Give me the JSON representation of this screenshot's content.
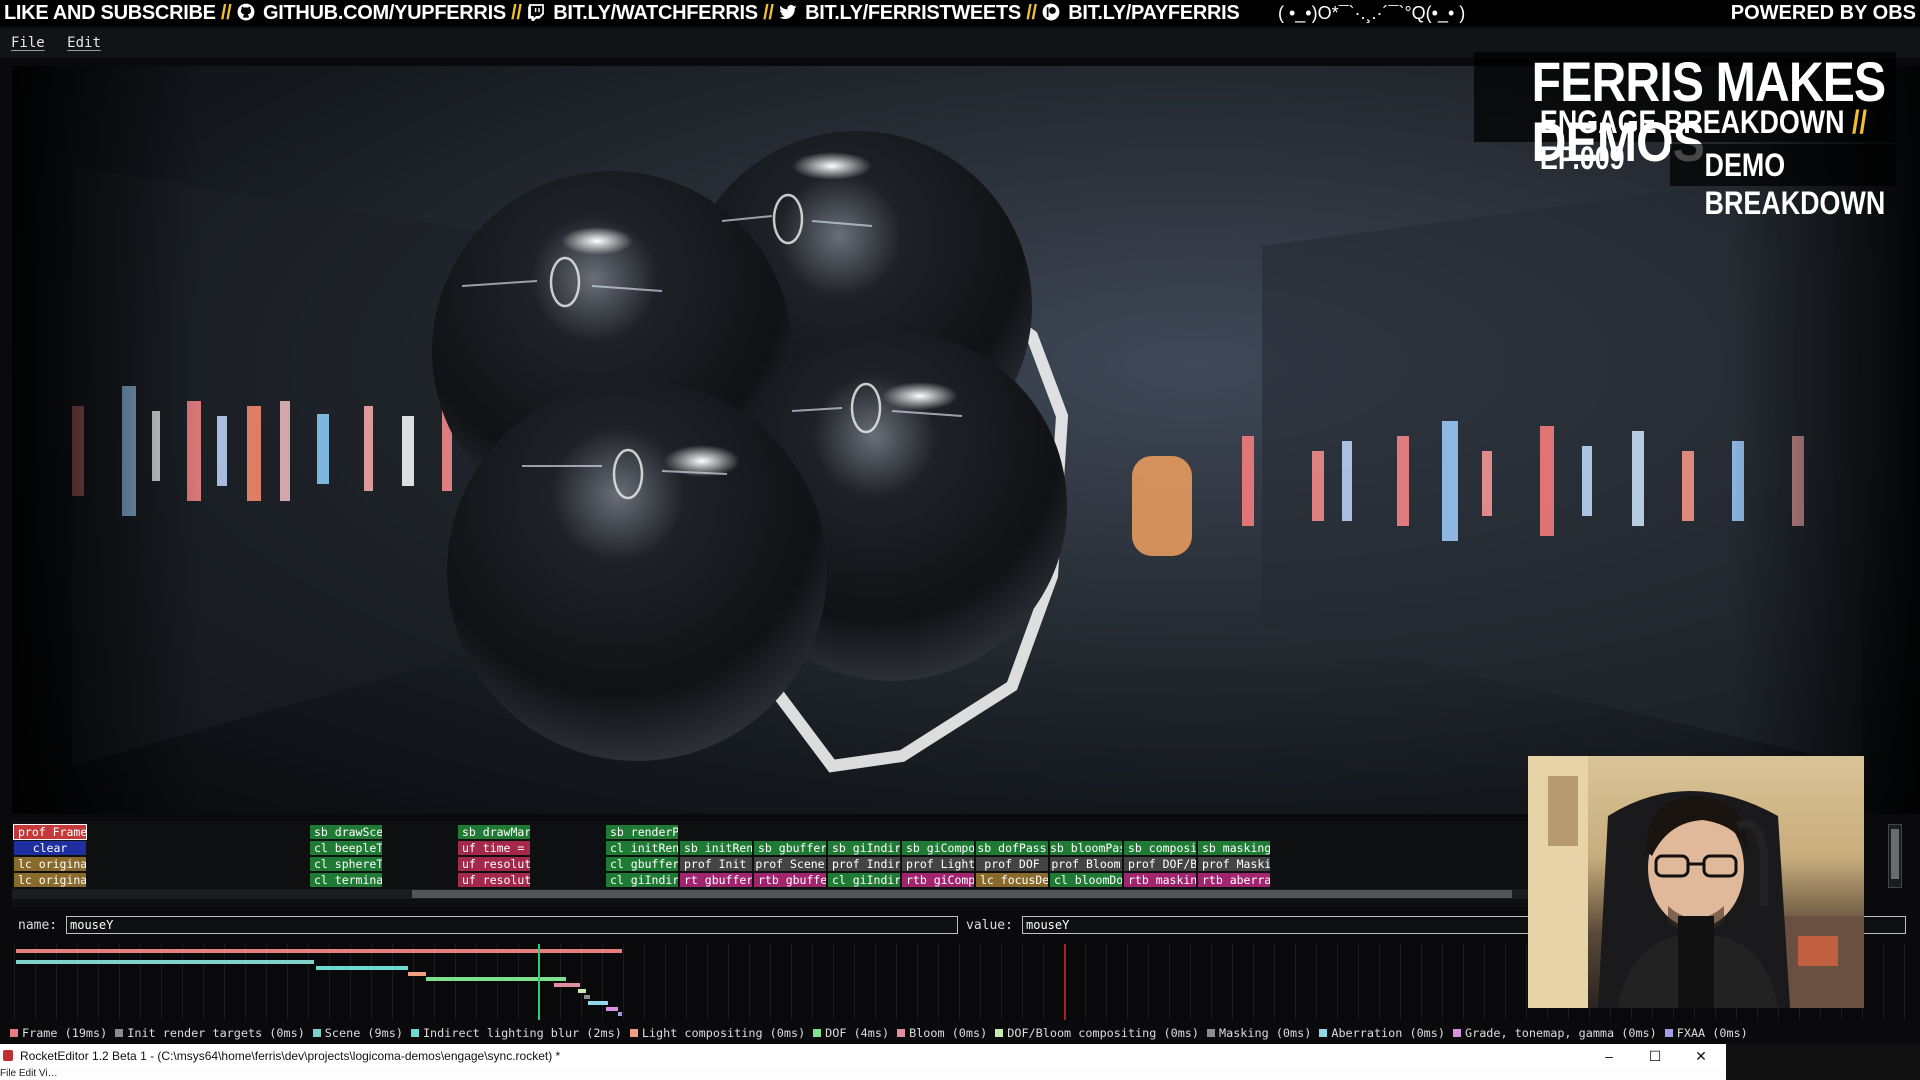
{
  "ticker": {
    "left_parts": [
      "LIKE AND SUBSCRIBE",
      "GITHUB.COM/YUPFERRIS",
      "BIT.LY/WATCHFERRIS",
      "BIT.LY/FERRISTWEETS",
      "BIT.LY/PAYFERRIS"
    ],
    "separator": "//",
    "emoticon": "( •_•)O*¯`·.¸.·´¯`°Q(•_• )",
    "right": "POWERED BY OBS",
    "icons": [
      "github-icon",
      "twitch-icon",
      "twitter-icon",
      "patreon-icon"
    ]
  },
  "menu": {
    "file": "File",
    "edit": "Edit"
  },
  "banner": {
    "title": "FERRIS MAKES DEMOS",
    "subtitle_a": "ENGAGE BREAKDOWN",
    "subtitle_sep": "//",
    "subtitle_b": "EP.009",
    "tag": "DEMO BREAKDOWN"
  },
  "tracks": {
    "columns": [
      {
        "col": 0,
        "cells": [
          {
            "text": "prof Frame",
            "color": "#c43a3a",
            "outline": true
          },
          {
            "text": "clear",
            "color": "#1e2fa0",
            "center": true
          },
          {
            "text": "lc original…",
            "color": "#8a6a2a"
          },
          {
            "text": "lc original…",
            "color": "#8a6a2a"
          }
        ]
      },
      {
        "col": 1,
        "cells": []
      },
      {
        "col": 2,
        "cells": []
      },
      {
        "col": 3,
        "cells": []
      },
      {
        "col": 4,
        "cells": [
          {
            "text": "sb drawScene",
            "color": "#1f7a33"
          },
          {
            "text": "cl beepleTu…",
            "color": "#1f7a33"
          },
          {
            "text": "cl sphereTh…",
            "color": "#1f7a33"
          },
          {
            "text": "cl terminat…",
            "color": "#1f7a33"
          }
        ]
      },
      {
        "col": 5,
        "cells": []
      },
      {
        "col": 6,
        "cells": [
          {
            "text": "sb drawMarc…",
            "color": "#1f7a33"
          },
          {
            "text": "uf time = t…",
            "color": "#a3284a"
          },
          {
            "text": "uf resoluti…",
            "color": "#a3284a"
          },
          {
            "text": "uf resoluti…",
            "color": "#a3284a"
          }
        ]
      },
      {
        "col": 7,
        "cells": []
      },
      {
        "col": 8,
        "cells": [
          {
            "text": "sb renderPi…",
            "color": "#1f7a33"
          },
          {
            "text": "cl initRend…",
            "color": "#1f7a33"
          },
          {
            "text": "cl gbufferP…",
            "color": "#1f7a33"
          },
          {
            "text": "cl giIndire…",
            "color": "#1f7a33"
          }
        ]
      },
      {
        "col": 9,
        "cells": [
          null,
          {
            "text": "sb initRend…",
            "color": "#1f7a33"
          },
          {
            "text": "prof Init r…",
            "color": "#444"
          },
          {
            "text": "rt gbufferT…",
            "color": "#a0256e"
          }
        ]
      },
      {
        "col": 10,
        "cells": [
          null,
          {
            "text": "sb gbufferP…",
            "color": "#1f7a33"
          },
          {
            "text": "prof Scene",
            "color": "#444",
            "center": true
          },
          {
            "text": "rtb gbuffer…",
            "color": "#a0256e"
          }
        ]
      },
      {
        "col": 11,
        "cells": [
          null,
          {
            "text": "sb giIndire…",
            "color": "#1f7a33"
          },
          {
            "text": "prof Indire…",
            "color": "#444"
          },
          {
            "text": "cl giIndire…",
            "color": "#1f7a33"
          }
        ]
      },
      {
        "col": 12,
        "cells": [
          null,
          {
            "text": "sb giCompos…",
            "color": "#1f7a33"
          },
          {
            "text": "prof Light …",
            "color": "#444"
          },
          {
            "text": "rtb giCompo…",
            "color": "#a0256e"
          }
        ]
      },
      {
        "col": 13,
        "cells": [
          null,
          {
            "text": "sb dofPass",
            "color": "#1f7a33",
            "center": true
          },
          {
            "text": "prof DOF",
            "color": "#444",
            "center": true
          },
          {
            "text": "lc focusDep…",
            "color": "#8a6a2a"
          }
        ]
      },
      {
        "col": 14,
        "cells": [
          null,
          {
            "text": "sb bloomPass",
            "color": "#1f7a33",
            "center": true
          },
          {
            "text": "prof Bloom",
            "color": "#444",
            "center": true
          },
          {
            "text": "cl bloomDow…",
            "color": "#1f7a33"
          }
        ]
      },
      {
        "col": 15,
        "cells": [
          null,
          {
            "text": "sb composit…",
            "color": "#1f7a33"
          },
          {
            "text": "prof DOF/Bl…",
            "color": "#444"
          },
          {
            "text": "rtb masking…",
            "color": "#a0256e"
          }
        ]
      },
      {
        "col": 16,
        "cells": [
          null,
          {
            "text": "sb masking",
            "color": "#1f7a33"
          },
          {
            "text": "prof Maski…",
            "color": "#444"
          },
          {
            "text": "rtb aberra…",
            "color": "#a0256e"
          }
        ]
      }
    ]
  },
  "fields": {
    "name_label": "name:",
    "name_value": "mouseY",
    "value_label": "value:",
    "value_value": "mouseY"
  },
  "timing_legend": [
    {
      "label": "Frame (19ms)",
      "color": "#e87f7f"
    },
    {
      "label": "Init render targets (0ms)",
      "color": "#8c8c8c"
    },
    {
      "label": "Scene (9ms)",
      "color": "#7fd1c9"
    },
    {
      "label": "Indirect lighting blur (2ms)",
      "color": "#6fd8d0"
    },
    {
      "label": "Light compositing (0ms)",
      "color": "#f0a080"
    },
    {
      "label": "DOF (4ms)",
      "color": "#7fe08f"
    },
    {
      "label": "Bloom (0ms)",
      "color": "#e08f9f"
    },
    {
      "label": "DOF/Bloom compositing (0ms)",
      "color": "#c8e8b0"
    },
    {
      "label": "Masking (0ms)",
      "color": "#8c8c8c"
    },
    {
      "label": "Aberration (0ms)",
      "color": "#8fd8e8"
    },
    {
      "label": "Grade, tonemap, gamma (0ms)",
      "color": "#d890e0"
    },
    {
      "label": "FXAA (0ms)",
      "color": "#9f9fe8"
    }
  ],
  "window": {
    "title": "RocketEditor 1.2 Beta 1 - (C:\\msys64\\home\\ferris\\dev\\projects\\logicoma-demos\\engage\\sync.rocket) *",
    "menu_partial": "File  Edit  Vi…",
    "min": "–",
    "max": "☐",
    "close": "✕"
  }
}
